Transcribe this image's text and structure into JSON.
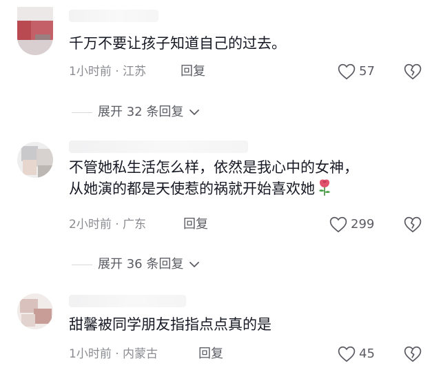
{
  "comments": [
    {
      "text_lines": [
        "千万不要让孩子知道自己的过去。"
      ],
      "meta": "1小时前 · 江苏",
      "reply_label": "回复",
      "likes": "57",
      "expand_label": "展开 32 条回复"
    },
    {
      "text_lines": [
        "不管她私生活怎么样，依然是我心中的女神，",
        "从她演的都是天使惹的祸就开始喜欢她"
      ],
      "meta": "2小时前 · 广东",
      "reply_label": "回复",
      "likes": "299",
      "expand_label": "展开 36 条回复",
      "emoji": "rose-icon"
    },
    {
      "text_lines": [
        "甜馨被同学朋友指指点点真的是"
      ],
      "meta": "1小时前 · 内蒙古",
      "reply_label": "回复",
      "likes": "45"
    }
  ],
  "colors": {
    "text": "#161823",
    "meta": "#8a8b91",
    "action": "#5b5c63",
    "divider": "#d8d8dc",
    "rose": "#e0526e"
  }
}
